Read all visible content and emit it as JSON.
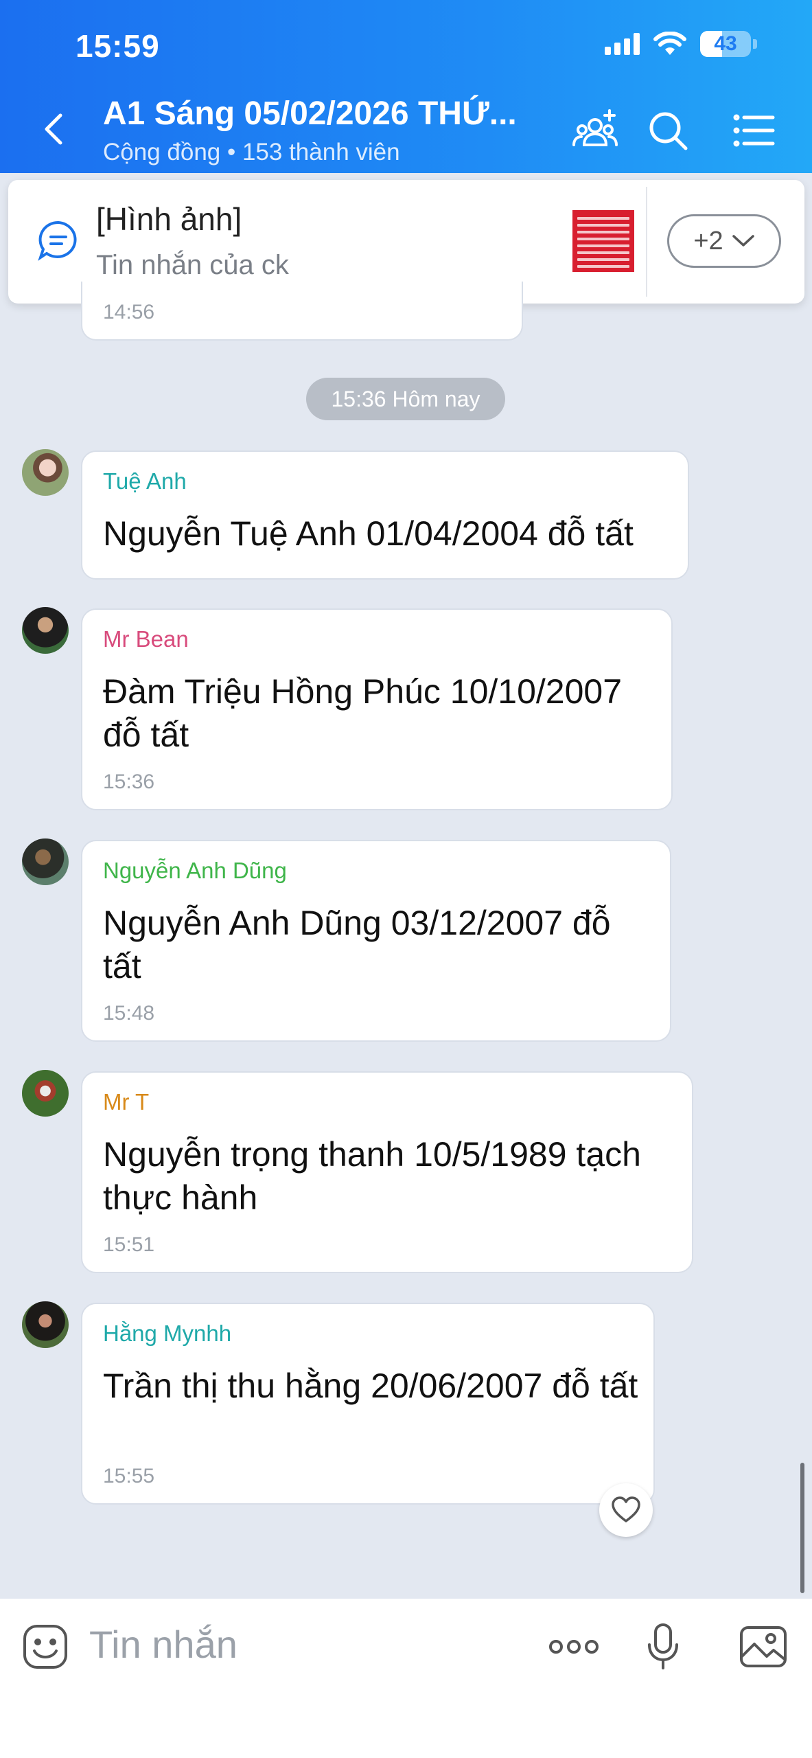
{
  "status_bar": {
    "time": "15:59",
    "battery": "43"
  },
  "header": {
    "title": "A1 Sáng 05/02/2026 THỨ...",
    "subtitle": "Cộng đồng • 153 thành viên"
  },
  "pinned": {
    "title": "[Hình ảnh]",
    "subtitle": "Tin nhắn của ck",
    "more_label": "+2"
  },
  "previous_message_time": "14:56",
  "date_separator": "15:36 Hôm nay",
  "messages": [
    {
      "sender": "Tuệ Anh",
      "sender_color": "#1fa9a9",
      "text": "Nguyễn Tuệ Anh 01/04/2004 đỗ tất",
      "time": ""
    },
    {
      "sender": "Mr Bean",
      "sender_color": "#d84b7c",
      "text": "Đàm Triệu Hồng Phúc 10/10/2007 đỗ tất",
      "time": "15:36"
    },
    {
      "sender": "Nguyễn Anh Dũng",
      "sender_color": "#3fb54a",
      "text": "Nguyễn Anh Dũng 03/12/2007 đỗ tất",
      "time": "15:48"
    },
    {
      "sender": "Mr T",
      "sender_color": "#d88a1a",
      "text": "Nguyễn trọng thanh 10/5/1989 tạch thực hành",
      "time": "15:51"
    },
    {
      "sender": "Hằng Mynhh",
      "sender_color": "#1fa9a9",
      "text": "Trần thị thu hằng 20/06/2007 đỗ tất",
      "time": "15:55"
    }
  ],
  "input": {
    "placeholder": "Tin nhắn"
  },
  "icons": {
    "back": "chevron-left-icon",
    "group": "group-add-icon",
    "search": "search-icon",
    "menu": "list-menu-icon",
    "emoji": "emoji-icon",
    "more": "more-dots-icon",
    "mic": "microphone-icon",
    "image": "image-icon",
    "heart": "heart-icon"
  }
}
